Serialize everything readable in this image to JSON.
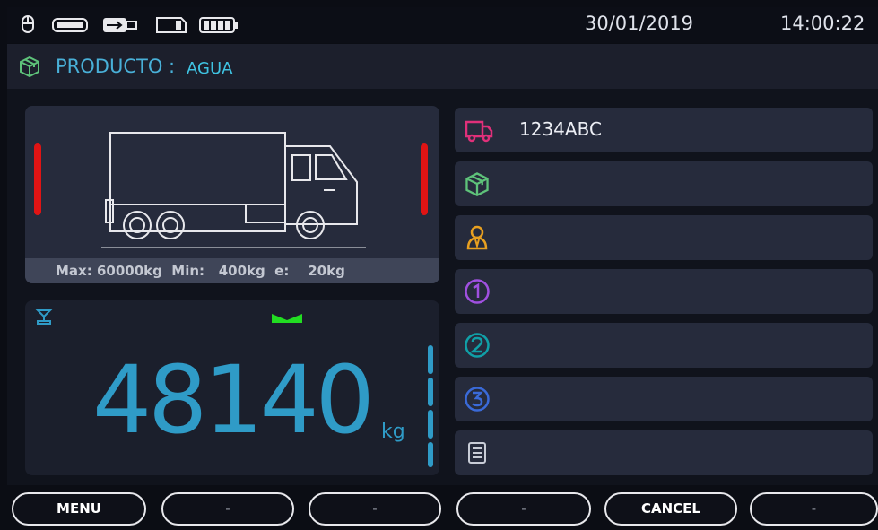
{
  "status": {
    "date": "30/01/2019",
    "time": "14:00:22",
    "icons": [
      "mouse-icon",
      "keyboard-icon",
      "usb-icon",
      "sd-card-icon",
      "battery-icon"
    ]
  },
  "product": {
    "label": "PRODUCTO :",
    "value": "AGUA",
    "icon": "product-box-icon"
  },
  "truck": {
    "limits_text": "Max: 60000kg  Min:   400kg  e:    20kg",
    "indicator_color": "#e01414"
  },
  "weight": {
    "value": "48140",
    "unit": "kg",
    "color": "#2f9bc7",
    "stable_indicator_color": "#22dd22"
  },
  "fields": [
    {
      "icon": "truck-icon",
      "value": "1234ABC",
      "color": "#e0307a"
    },
    {
      "icon": "product-box-icon",
      "value": "",
      "color": "#5ec27a"
    },
    {
      "icon": "driver-icon",
      "value": "",
      "color": "#e8a020"
    },
    {
      "icon": "number-1-icon",
      "value": "",
      "color": "#a050e0"
    },
    {
      "icon": "number-2-icon",
      "value": "",
      "color": "#10a0a8"
    },
    {
      "icon": "number-3-icon",
      "value": "",
      "color": "#3a6ad8"
    },
    {
      "icon": "notes-icon",
      "value": "",
      "color": "#c8ccd6"
    }
  ],
  "softkeys": [
    "MENU",
    "-",
    "-",
    "-",
    "CANCEL",
    "-"
  ]
}
